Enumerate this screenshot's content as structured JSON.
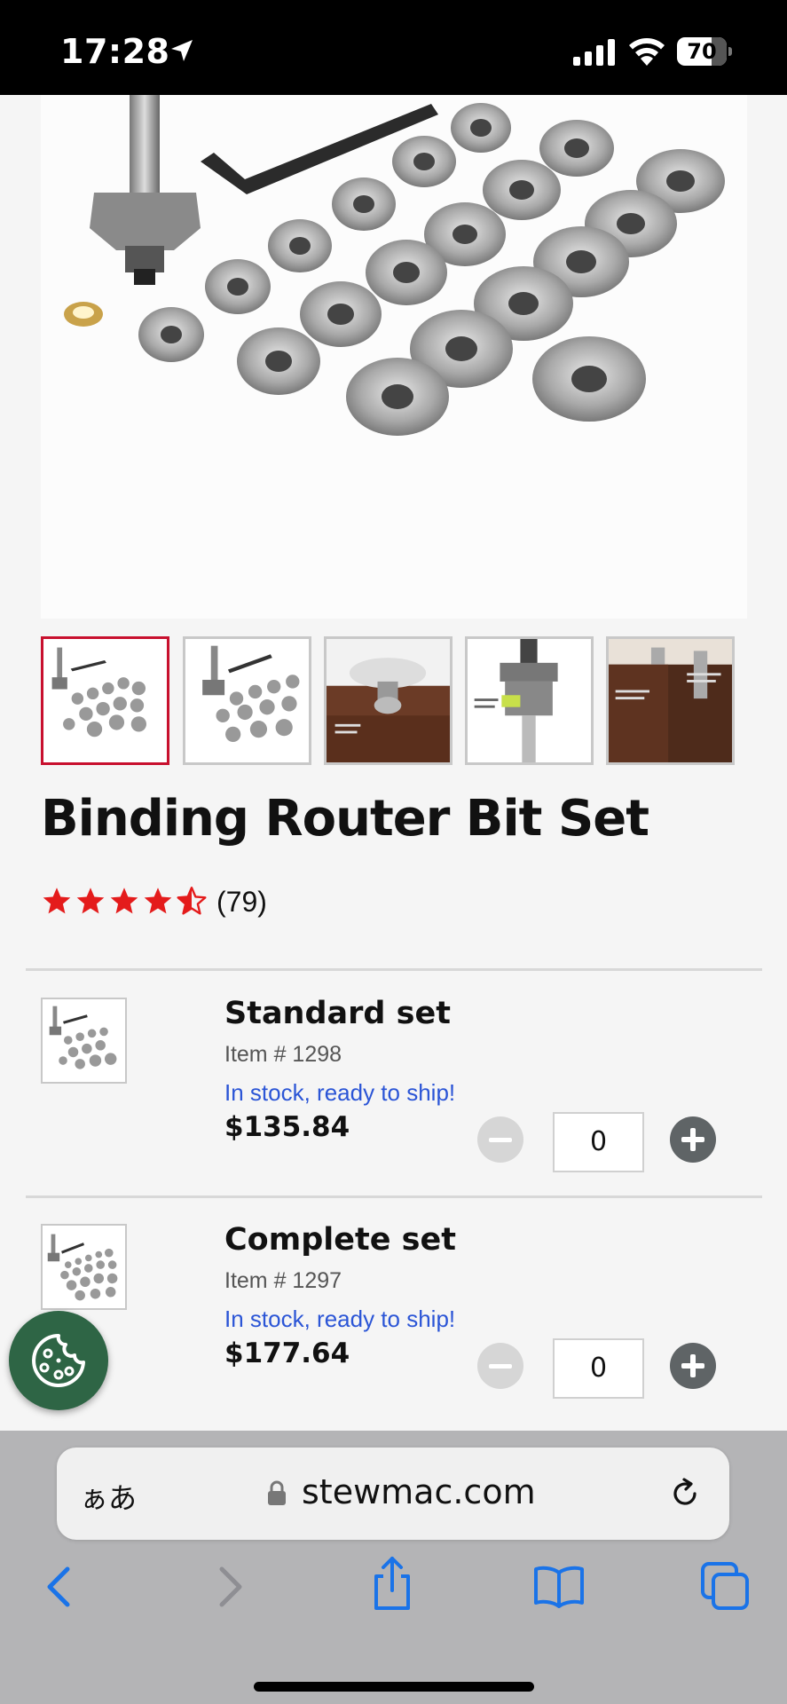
{
  "status_bar": {
    "time": "17:28",
    "battery": "70",
    "battery_level": 0.7
  },
  "product": {
    "title": "Binding Router Bit Set",
    "rating": 4.5,
    "rating_count": "(79)",
    "thumbnails_count": 5,
    "active_thumbnail": 1
  },
  "variants": [
    {
      "name": "Standard set",
      "item": "Item # 1298",
      "stock": "In stock, ready to ship!",
      "price": "$135.84",
      "quantity": "0"
    },
    {
      "name": "Complete set",
      "item": "Item # 1297",
      "stock": "In stock, ready to ship!",
      "price": "$177.64",
      "quantity": "0"
    }
  ],
  "browser": {
    "aa_label": "ぁあ",
    "url": "stewmac.com"
  },
  "colors": {
    "accent_red": "#c8102e",
    "stock_blue": "#2b55d6",
    "cookie_green": "#2e6545",
    "ios_blue": "#1a73e8"
  },
  "icons": [
    "location-arrow-icon",
    "signal-icon",
    "wifi-icon",
    "battery-icon",
    "star-icon",
    "half-star-icon",
    "minus-icon",
    "plus-icon",
    "cookie-icon",
    "lock-icon",
    "reload-icon",
    "back-icon",
    "forward-icon",
    "share-icon",
    "bookmarks-icon",
    "tabs-icon"
  ]
}
